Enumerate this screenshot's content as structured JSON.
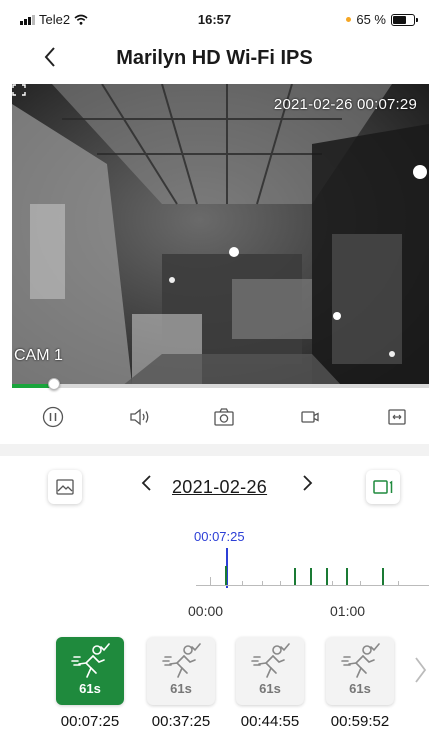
{
  "status_bar": {
    "carrier": "Tele2",
    "time": "16:57",
    "battery": "65 %",
    "battery_level": 0.65
  },
  "nav": {
    "back_icon": "chevron-left-icon",
    "title": "Marilyn HD Wi-Fi IPS"
  },
  "video": {
    "timestamp": "2021-02-26 00:07:29",
    "camera_label": "CAM 1",
    "playback_progress": 0.1
  },
  "controls": {
    "icons": [
      "pause-icon",
      "speaker-icon",
      "snapshot-icon",
      "record-icon",
      "fit-screen-icon"
    ]
  },
  "date_bar": {
    "date": "2021-02-26",
    "prev_icon": "chevron-left-icon",
    "next_icon": "chevron-right-icon",
    "left_button_icon": "image-icon",
    "right_button_icon": "single-view-icon"
  },
  "timeline": {
    "cursor_label": "00:07:25",
    "labels": [
      "00:00",
      "01:00"
    ]
  },
  "events": {
    "items": [
      {
        "duration": "61s",
        "time": "00:07:25",
        "active": true
      },
      {
        "duration": "61s",
        "time": "00:37:25",
        "active": false
      },
      {
        "duration": "61s",
        "time": "00:44:55",
        "active": false
      },
      {
        "duration": "61s",
        "time": "00:59:52",
        "active": false
      }
    ],
    "next_icon": "chevron-right-icon"
  },
  "colors": {
    "accent_green": "#1f8a3d",
    "timeline_blue": "#2c3fd6"
  }
}
